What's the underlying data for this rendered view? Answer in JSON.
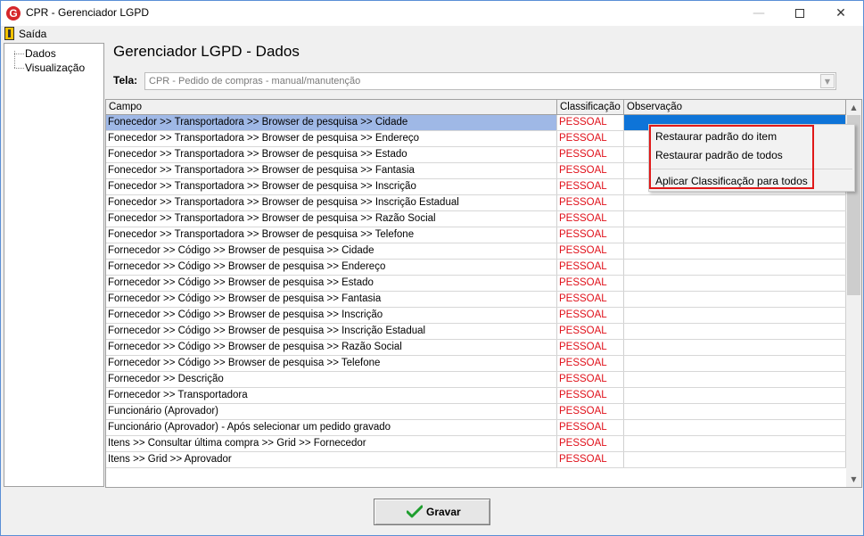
{
  "window": {
    "title": "CPR - Gerenciador LGPD",
    "logo_letter": "G",
    "minimize_glyph": "—",
    "close_glyph": "✕"
  },
  "menubar": {
    "exit_label": "Saída",
    "exit_icon": "exit-door-icon"
  },
  "tree": {
    "items": [
      {
        "label": "Dados"
      },
      {
        "label": "Visualização"
      }
    ]
  },
  "page": {
    "title": "Gerenciador LGPD - Dados",
    "tela_label": "Tela:",
    "tela_value": "CPR - Pedido de compras - manual/manutenção"
  },
  "grid": {
    "headers": {
      "campo": "Campo",
      "classificacao": "Classificação",
      "observacao": "Observação"
    },
    "rows": [
      {
        "campo": "Fonecedor >> Transportadora >> Browser de pesquisa >> Cidade",
        "classificacao": "PESSOAL",
        "observacao": ""
      },
      {
        "campo": "Fonecedor >> Transportadora >> Browser de pesquisa >> Endereço",
        "classificacao": "PESSOAL",
        "observacao": ""
      },
      {
        "campo": "Fonecedor >> Transportadora >> Browser de pesquisa >> Estado",
        "classificacao": "PESSOAL",
        "observacao": ""
      },
      {
        "campo": "Fonecedor >> Transportadora >> Browser de pesquisa >> Fantasia",
        "classificacao": "PESSOAL",
        "observacao": ""
      },
      {
        "campo": "Fonecedor >> Transportadora >> Browser de pesquisa >> Inscrição",
        "classificacao": "PESSOAL",
        "observacao": ""
      },
      {
        "campo": "Fonecedor >> Transportadora >> Browser de pesquisa >> Inscrição Estadual",
        "classificacao": "PESSOAL",
        "observacao": ""
      },
      {
        "campo": "Fonecedor >> Transportadora >> Browser de pesquisa >> Razão Social",
        "classificacao": "PESSOAL",
        "observacao": ""
      },
      {
        "campo": "Fonecedor >> Transportadora >> Browser de pesquisa >> Telefone",
        "classificacao": "PESSOAL",
        "observacao": ""
      },
      {
        "campo": "Fornecedor >> Código >> Browser de pesquisa >> Cidade",
        "classificacao": "PESSOAL",
        "observacao": ""
      },
      {
        "campo": "Fornecedor >> Código >> Browser de pesquisa >> Endereço",
        "classificacao": "PESSOAL",
        "observacao": ""
      },
      {
        "campo": "Fornecedor >> Código >> Browser de pesquisa >> Estado",
        "classificacao": "PESSOAL",
        "observacao": ""
      },
      {
        "campo": "Fornecedor >> Código >> Browser de pesquisa >> Fantasia",
        "classificacao": "PESSOAL",
        "observacao": ""
      },
      {
        "campo": "Fornecedor >> Código >> Browser de pesquisa >> Inscrição",
        "classificacao": "PESSOAL",
        "observacao": ""
      },
      {
        "campo": "Fornecedor >> Código >> Browser de pesquisa >> Inscrição Estadual",
        "classificacao": "PESSOAL",
        "observacao": ""
      },
      {
        "campo": "Fornecedor >> Código >> Browser de pesquisa >> Razão Social",
        "classificacao": "PESSOAL",
        "observacao": ""
      },
      {
        "campo": "Fornecedor >> Código >> Browser de pesquisa >> Telefone",
        "classificacao": "PESSOAL",
        "observacao": ""
      },
      {
        "campo": "Fornecedor >> Descrição",
        "classificacao": "PESSOAL",
        "observacao": ""
      },
      {
        "campo": "Fornecedor >> Transportadora",
        "classificacao": "PESSOAL",
        "observacao": ""
      },
      {
        "campo": "Funcionário (Aprovador)",
        "classificacao": "PESSOAL",
        "observacao": ""
      },
      {
        "campo": "Funcionário (Aprovador) -  Após selecionar um pedido gravado",
        "classificacao": "PESSOAL",
        "observacao": ""
      },
      {
        "campo": "Itens >> Consultar última compra >> Grid >> Fornecedor",
        "classificacao": "PESSOAL",
        "observacao": ""
      },
      {
        "campo": "Itens >> Grid >> Aprovador",
        "classificacao": "PESSOAL",
        "observacao": ""
      }
    ],
    "selected_row_index": 0
  },
  "context_menu": {
    "items": [
      {
        "label": "Restaurar padrão do item"
      },
      {
        "label": "Restaurar padrão de todos"
      },
      {
        "label": "Aplicar Classificação para todos"
      }
    ]
  },
  "footer": {
    "save_label": "Gravar"
  },
  "colors": {
    "classification_text": "#e0101a",
    "selected_row": "#9fb8e6",
    "selected_cell": "#0e74d8",
    "highlight_border": "#e01818",
    "check_green": "#1e9e2e"
  }
}
